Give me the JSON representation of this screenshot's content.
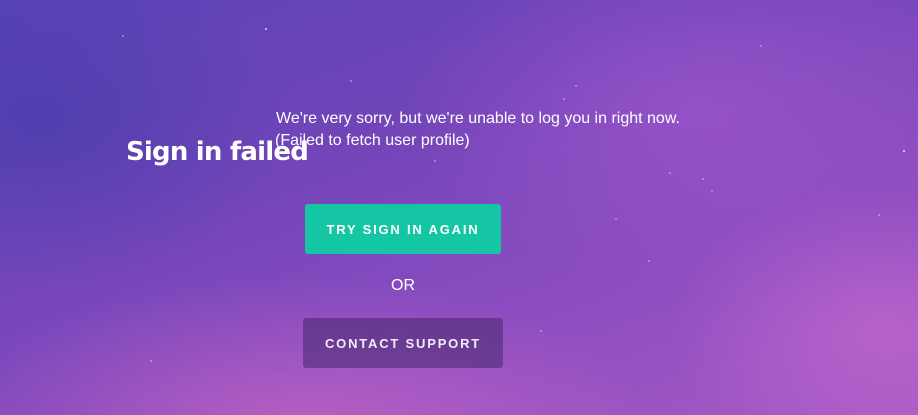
{
  "error": {
    "title": "Sign in failed",
    "message": "We're very sorry, but we're unable to log you in right now.",
    "detail": "(Failed to fetch user profile)"
  },
  "actions": {
    "retry_label": "TRY SIGN IN AGAIN",
    "separator": "OR",
    "support_label": "CONTACT SUPPORT"
  },
  "colors": {
    "primary_button": "#14c6a3",
    "secondary_button": "#5a3486",
    "text": "#ffffff"
  }
}
